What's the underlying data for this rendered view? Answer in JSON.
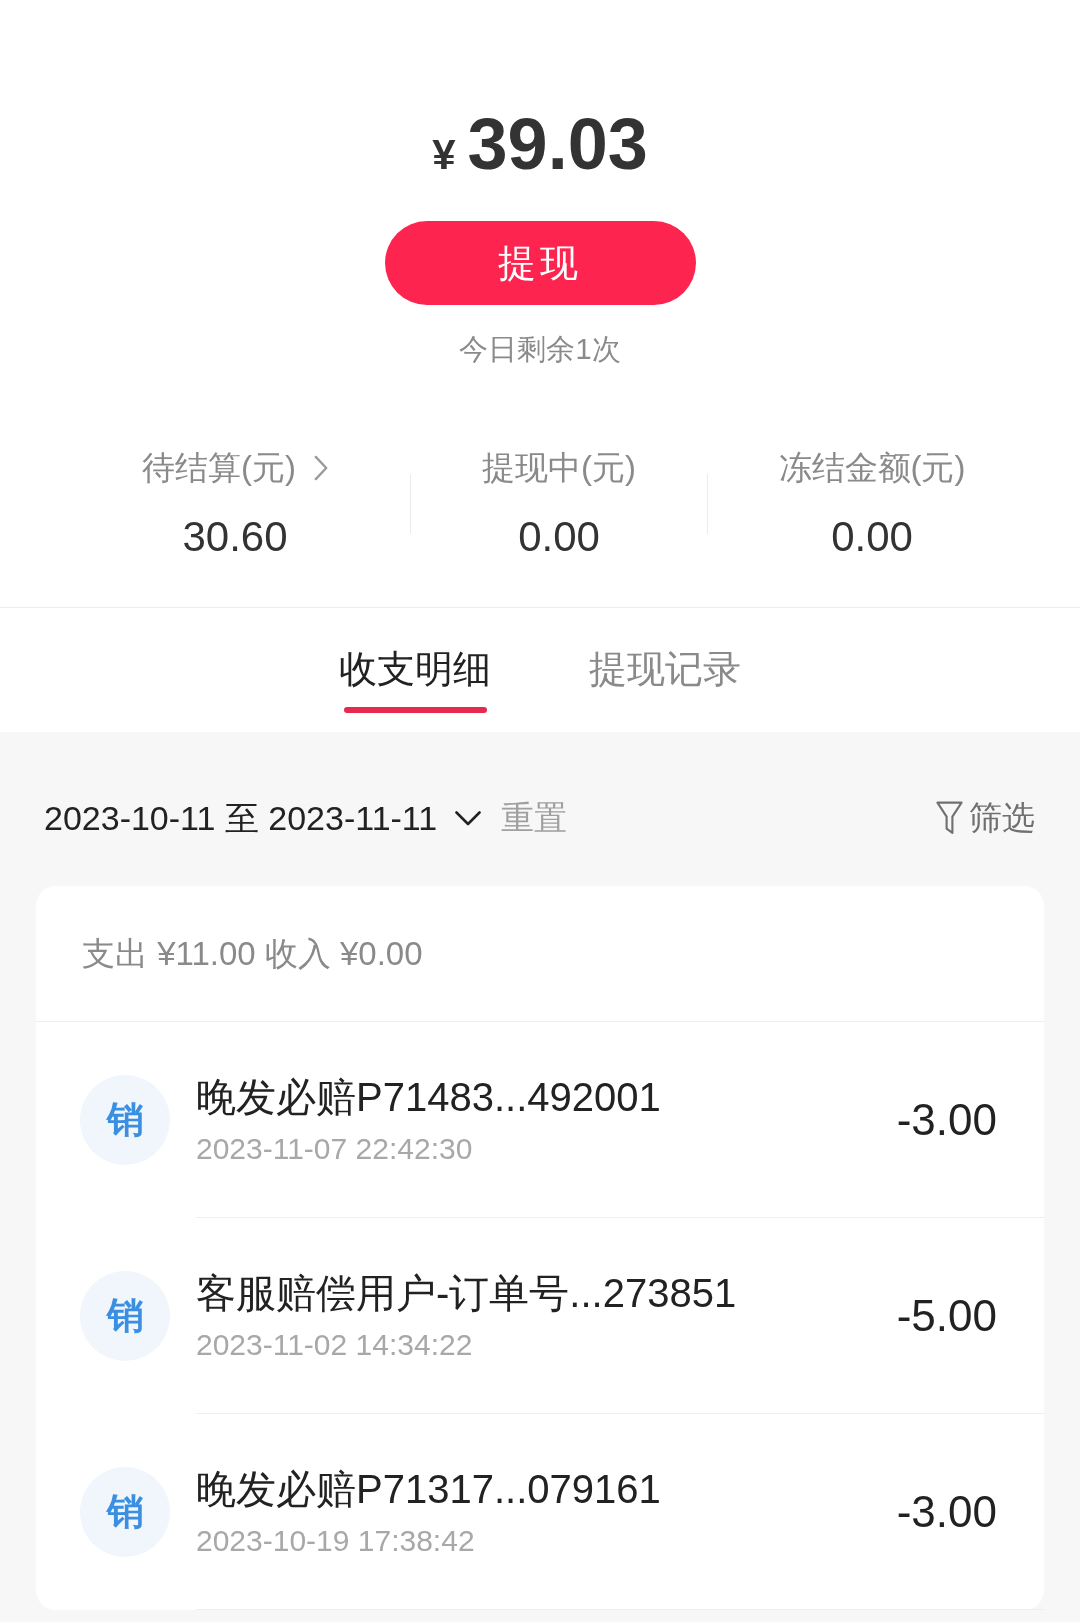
{
  "balance": {
    "currency": "¥",
    "amount": "39.03"
  },
  "withdraw_button": {
    "label": "提现"
  },
  "remaining_note": "今日剩余1次",
  "stats": [
    {
      "label": "待结算(元)",
      "value": "30.60",
      "kind": "link"
    },
    {
      "label": "提现中(元)",
      "value": "0.00",
      "kind": "plain"
    },
    {
      "label": "冻结金额(元)",
      "value": "0.00",
      "kind": "plain"
    }
  ],
  "tabs": [
    {
      "label": "收支明细",
      "selected": true
    },
    {
      "label": "提现记录",
      "selected": false
    }
  ],
  "filter_bar": {
    "date_range": "2023-10-11 至 2023-11-11",
    "reset": "重置",
    "filter": "筛选"
  },
  "summary": "支出 ¥11.00 收入 ¥0.00",
  "transactions": [
    {
      "badge": "销",
      "title": "晚发必赔P71483...492001",
      "time": "2023-11-07 22:42:30",
      "amount": "-3.00"
    },
    {
      "badge": "销",
      "title": "客服赔偿用户-订单号...273851",
      "time": "2023-11-02 14:34:22",
      "amount": "-5.00"
    },
    {
      "badge": "销",
      "title": "晚发必赔P71317...079161",
      "time": "2023-10-19 17:38:42",
      "amount": "-3.00"
    }
  ]
}
